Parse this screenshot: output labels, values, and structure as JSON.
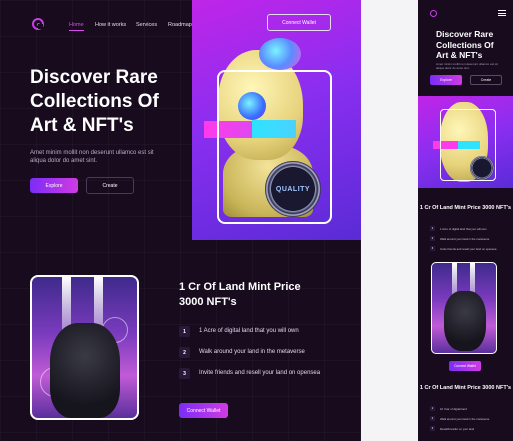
{
  "nav": {
    "items": [
      "Home",
      "How it works",
      "Services",
      "Roadmap"
    ],
    "wallet_label": "Connect Wallet"
  },
  "hero": {
    "title_line1": "Discover Rare",
    "title_line2": "Collections Of",
    "title_line3a": "Art & ",
    "title_line3b": "NFT's",
    "subtitle": "Amet minim mollit non deserunt ullamco est sit aliqua dolor do amet sint.",
    "explore_label": "Explore",
    "create_label": "Create",
    "seal_text": "QUALITY"
  },
  "land": {
    "title_line1": "1 Cr Of Land Mint Price",
    "title_line2": "3000 NFT's",
    "features": [
      {
        "num": "1",
        "text": "1 Acre of digital land that you will own"
      },
      {
        "num": "2",
        "text": "Walk around your land in the metaverse"
      },
      {
        "num": "3",
        "text": "Invite friends and resell your land on opensea"
      }
    ],
    "wallet_label": "Connect Wallet"
  },
  "mobile": {
    "title": "Discover Rare Collections Of Art & NFT's",
    "subtitle": "Amet minim mollit non deserunt ullamco est sit aliqua dolor do amet sint.",
    "explore_label": "Explore",
    "create_label": "Create",
    "sec1_title": "1 Cr Of Land Mint Price 3000 NFT's",
    "sec1_features": [
      {
        "num": "1",
        "text": "1 Acre of digital land that you will own"
      },
      {
        "num": "2",
        "text": "Walk around your land in the metaverse"
      },
      {
        "num": "3",
        "text": "Invite friends and resell your land on opensea"
      }
    ],
    "wallet_label": "Connect Wallet",
    "sec2_title": "1 Cr Of Land Mint Price 3000 NFT's",
    "sec2_features": [
      {
        "num": "1",
        "text": "10 Year of digital land"
      },
      {
        "num": "2",
        "text": "Walk around your land in the metaverse"
      },
      {
        "num": "3",
        "text": "Resell/transfer on your land"
      }
    ]
  },
  "colors": {
    "background": "#170b1d",
    "accent_purple": "#7b2cf6",
    "accent_pink": "#d13be3",
    "nav_active": "#d94cf0"
  }
}
